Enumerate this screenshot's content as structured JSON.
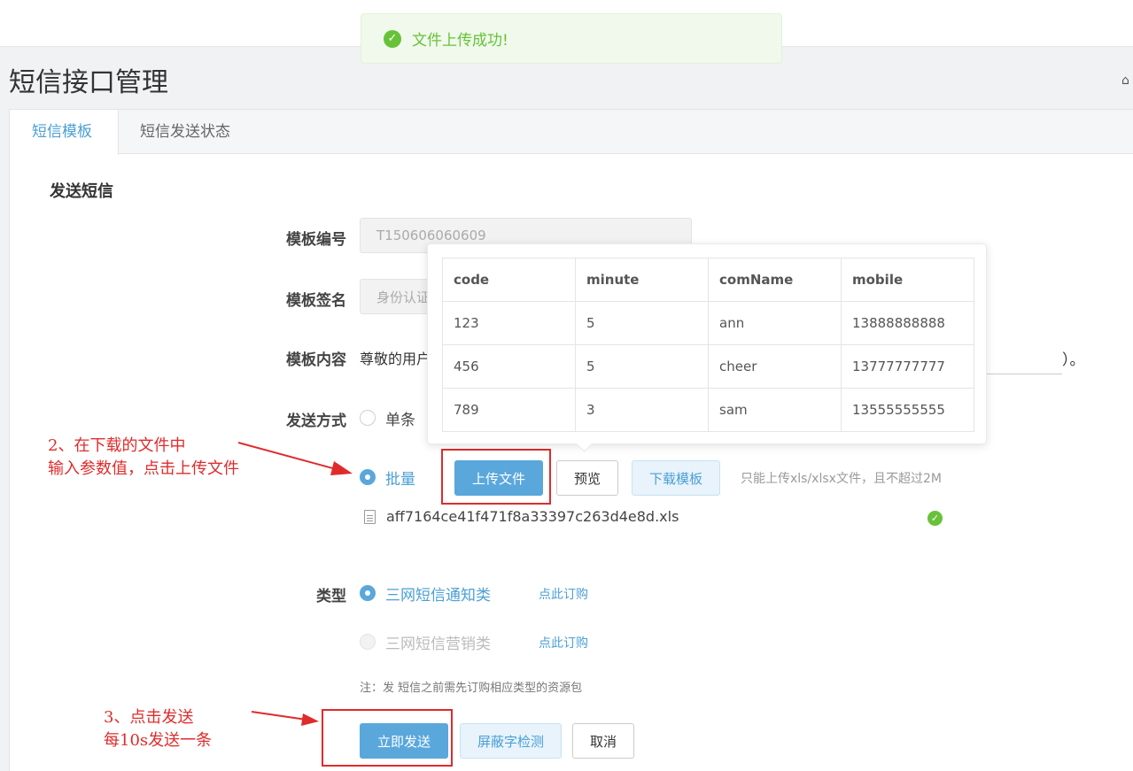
{
  "toast": {
    "message": "文件上传成功!"
  },
  "page": {
    "title": "短信接口管理"
  },
  "tabs": [
    {
      "label": "短信模板"
    },
    {
      "label": "短信发送状态"
    }
  ],
  "form": {
    "section_title": "发送短信",
    "template_id": {
      "label": "模板编号",
      "value": "T150606060609"
    },
    "template_sign": {
      "label": "模板签名",
      "value": "身份认证"
    },
    "template_content": {
      "label": "模板内容",
      "value": "尊敬的用户",
      "tail": "）。"
    },
    "send_mode": {
      "label": "发送方式",
      "single_label": "单条",
      "batch_label": "批量"
    },
    "upload_button": "上传文件",
    "preview_button": "预览",
    "download_button": "下载模板",
    "upload_hint": "只能上传xls/xlsx文件，且不超过2M",
    "uploaded_file": "aff7164ce41f471f8a33397c263d4e8d.xls",
    "type": {
      "label": "类型",
      "options": [
        {
          "label": "三网短信通知类",
          "link": "点此订购",
          "selected": true
        },
        {
          "label": "三网短信营销类",
          "link": "点此订购",
          "selected": false
        }
      ]
    },
    "note": "注：发 短信之前需先订购相应类型的资源包",
    "send_button": "立即发送",
    "check_button": "屏蔽字检测",
    "cancel_button": "取消"
  },
  "preview_table": {
    "headers": [
      "code",
      "minute",
      "comName",
      "mobile"
    ],
    "rows": [
      [
        "123",
        "5",
        "ann",
        "13888888888"
      ],
      [
        "456",
        "5",
        "cheer",
        "13777777777"
      ],
      [
        "789",
        "3",
        "sam",
        "13555555555"
      ]
    ]
  },
  "annotations": {
    "step2": "2、在下载的文件中\n输入参数值，点击上传文件",
    "step3": "3、点击发送\n每10s发送一条"
  },
  "colors": {
    "primary": "#5aa7dc",
    "success": "#67c23a",
    "annotation": "#e02b2b"
  }
}
